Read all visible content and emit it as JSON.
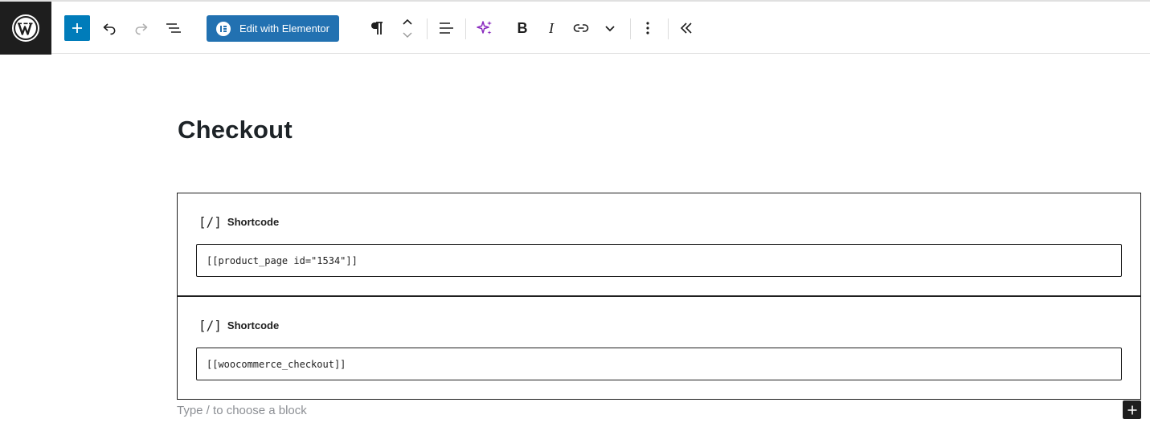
{
  "toolbar": {
    "logo_icon": "wordpress-icon",
    "inserter_icon": "plus-icon",
    "undo_icon": "undo-icon",
    "redo_icon": "redo-icon",
    "document_overview_icon": "list-view-icon",
    "elementor_button_label": "Edit with Elementor",
    "elementor_icon": "elementor-icon",
    "paragraph_icon": "pilcrow-icon",
    "move_icons": [
      "chevron-up-icon",
      "chevron-down-icon"
    ],
    "align_icon": "align-left-icon",
    "ai_icon": "sparkles-icon",
    "bold_label": "B",
    "italic_label": "I",
    "link_icon": "link-icon",
    "more_format_icon": "chevron-down-icon",
    "options_icon": "more-vertical-icon",
    "collapse_icon": "chevrons-left-icon",
    "colors": {
      "inserter": "#007cba",
      "elementor": "#2271b1",
      "ai": "#8a2bbf",
      "logo_bg": "#1e1e1e",
      "redo_disabled": "#b0b0b0"
    }
  },
  "editor": {
    "page_title": "Checkout",
    "blocks": [
      {
        "type_icon": "[/]",
        "label": "Shortcode",
        "value": "[[product_page id=\"1534\"]]"
      },
      {
        "type_icon": "[/]",
        "label": "Shortcode",
        "value": "[[woocommerce_checkout]]"
      }
    ],
    "appender_placeholder": "Type / to choose a block",
    "add_block_icon": "plus-icon"
  }
}
